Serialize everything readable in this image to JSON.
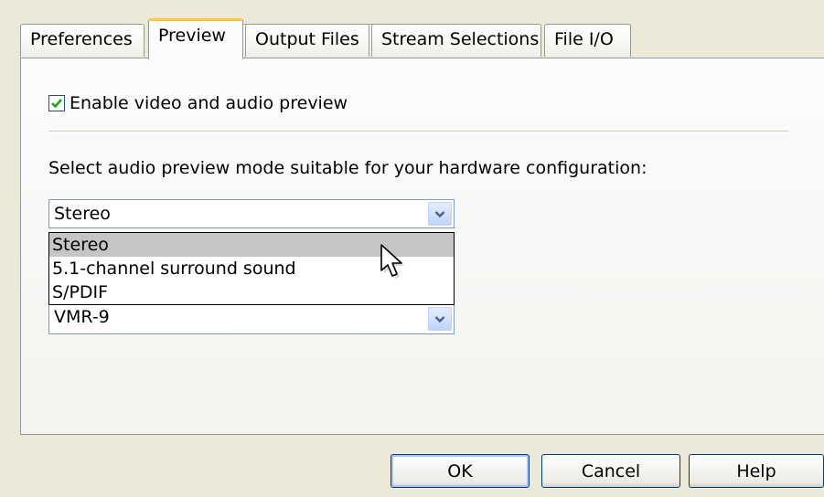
{
  "tabs": [
    {
      "label": "Preferences",
      "active": false
    },
    {
      "label": "Preview",
      "active": true
    },
    {
      "label": "Output Files",
      "active": false
    },
    {
      "label": "Stream Selections",
      "active": false
    },
    {
      "label": "File I/O",
      "active": false
    }
  ],
  "preview": {
    "enable_checkbox": {
      "label": "Enable video and audio preview",
      "checked": true
    },
    "audio_mode_label": "Select audio preview mode suitable for your hardware configuration:",
    "audio_mode_selected": "Stereo",
    "audio_mode_options": [
      "Stereo",
      "5.1-channel surround sound",
      "S/PDIF"
    ],
    "audio_mode_highlighted": "Stereo",
    "video_renderer_selected": "VMR-9"
  },
  "buttons": {
    "ok": "OK",
    "cancel": "Cancel",
    "help": "Help"
  },
  "colors": {
    "accent_tab": "#ffc83c",
    "checkmark": "#21a121",
    "highlight": "#c6c5c5",
    "border": "#919b9c"
  },
  "icons": {
    "dropdown": "chevron-down-icon",
    "checkbox": "checkmark-icon",
    "cursor": "mouse-pointer-icon"
  }
}
